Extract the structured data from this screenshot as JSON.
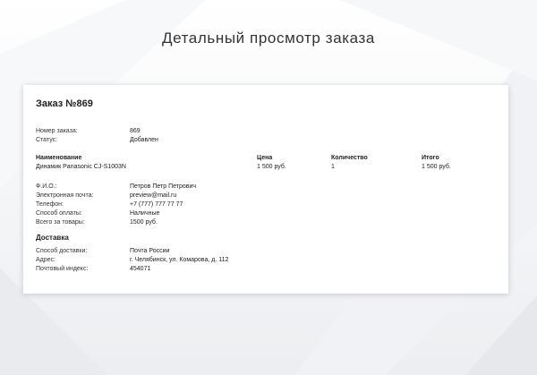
{
  "page_title": "Детальный просмотр заказа",
  "order": {
    "title": "Заказ №869",
    "info": [
      {
        "label": "Номер заказа:",
        "value": "869"
      },
      {
        "label": "Статус:",
        "value": "Добавлен"
      }
    ]
  },
  "items_table": {
    "headers": [
      "Наименование",
      "Цена",
      "Количество",
      "Итого"
    ],
    "rows": [
      {
        "name": "Динамик Panasonic CJ-S1003N",
        "price": "1 500 руб.",
        "qty": "1",
        "total": "1 500 руб."
      }
    ]
  },
  "customer": [
    {
      "label": "Ф.И.О.:",
      "value": "Петров Петр Петрович"
    },
    {
      "label": "Электронная почта:",
      "value": "preview@mail.ru"
    },
    {
      "label": "Телефон:",
      "value": "+7 (777) 777 77 77"
    },
    {
      "label": "Способ оплаты:",
      "value": "Наличные"
    },
    {
      "label": "Всего за товары:",
      "value": "1500 руб."
    }
  ],
  "delivery": {
    "title": "Доставка",
    "info": [
      {
        "label": "Способ доставки:",
        "value": "Почта России"
      },
      {
        "label": "Адрес:",
        "value": "г. Челябинск, ул. Комарова, д. 112"
      },
      {
        "label": "Почтовый индекс:",
        "value": "454071"
      }
    ]
  }
}
